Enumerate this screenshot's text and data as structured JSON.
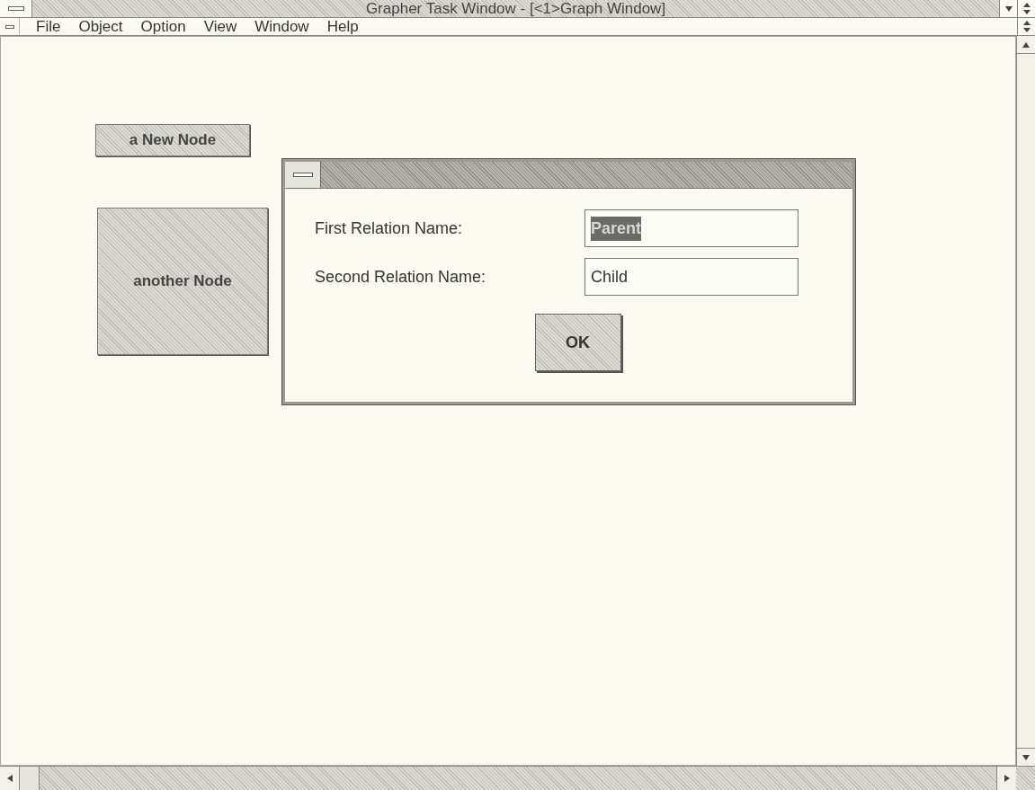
{
  "window": {
    "title": "Grapher Task Window - [<1>Graph Window]"
  },
  "menu": [
    {
      "label": "File"
    },
    {
      "label": "Object"
    },
    {
      "label": "Option"
    },
    {
      "label": "View"
    },
    {
      "label": "Window"
    },
    {
      "label": "Help"
    }
  ],
  "nodes": [
    {
      "label": "a New Node",
      "kind": "small"
    },
    {
      "label": "another Node",
      "kind": "large"
    }
  ],
  "dialog": {
    "fields": [
      {
        "label": "First Relation Name:",
        "value": "Parent",
        "selected": true
      },
      {
        "label": "Second Relation Name:",
        "value": "Child",
        "selected": false
      }
    ],
    "button": "OK"
  }
}
